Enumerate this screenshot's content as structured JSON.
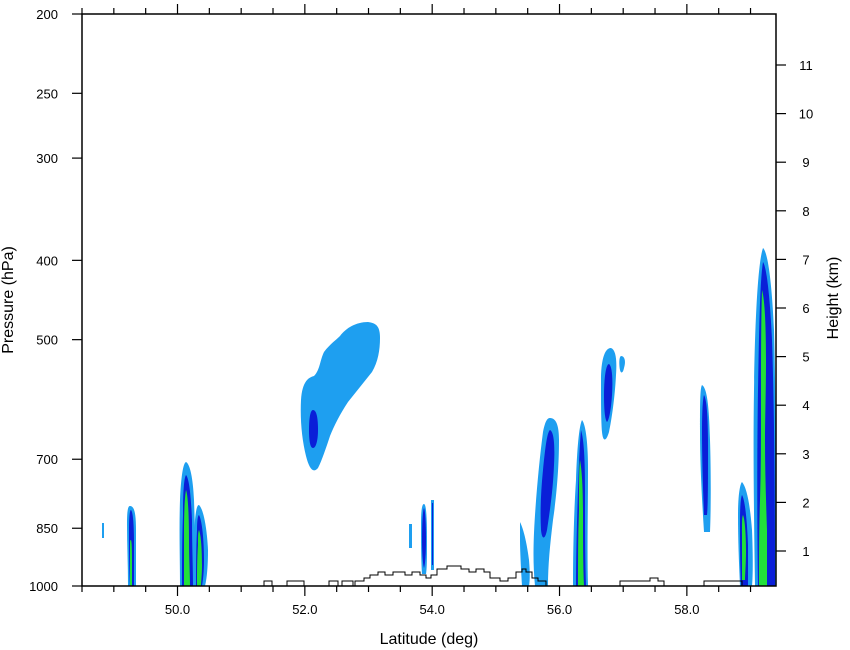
{
  "chart_data": {
    "type": "contour",
    "title": "",
    "xlabel": "Latitude (deg)",
    "ylabel_left": "Pressure (hPa)",
    "ylabel_right": "Height (km)",
    "xlim": [
      48.5,
      59.4
    ],
    "ylim_pressure": [
      1000,
      200
    ],
    "pressure_scale": "log",
    "x_ticks": [
      {
        "value": 50,
        "label": "50.0"
      },
      {
        "value": 52,
        "label": "52.0"
      },
      {
        "value": 54,
        "label": "54.0"
      },
      {
        "value": 56,
        "label": "56.0"
      },
      {
        "value": 58,
        "label": "58.0"
      }
    ],
    "y_ticks_pressure": [
      {
        "value": 200,
        "label": "200"
      },
      {
        "value": 250,
        "label": "250"
      },
      {
        "value": 300,
        "label": "300"
      },
      {
        "value": 400,
        "label": "400"
      },
      {
        "value": 500,
        "label": "500"
      },
      {
        "value": 700,
        "label": "700"
      },
      {
        "value": 850,
        "label": "850"
      },
      {
        "value": 1000,
        "label": "1000"
      }
    ],
    "y_ticks_height": [
      {
        "value": 1,
        "label": "1"
      },
      {
        "value": 2,
        "label": "2"
      },
      {
        "value": 3,
        "label": "3"
      },
      {
        "value": 4,
        "label": "4"
      },
      {
        "value": 5,
        "label": "5"
      },
      {
        "value": 6,
        "label": "6"
      },
      {
        "value": 7,
        "label": "7"
      },
      {
        "value": 8,
        "label": "8"
      },
      {
        "value": 9,
        "label": "9"
      },
      {
        "value": 10,
        "label": "10"
      },
      {
        "value": 11,
        "label": "11"
      }
    ],
    "colors": {
      "light_blue": "#1e9ff0",
      "dark_blue": "#0a1fd8",
      "green": "#22e03a",
      "terrain": "#000000"
    },
    "features": [
      {
        "name": "cell-49.2",
        "lat": 49.25,
        "p_top": 830,
        "p_bottom": 1000,
        "width": 0.1,
        "levels": [
          "light_blue",
          "dark_blue",
          "green"
        ]
      },
      {
        "name": "cell-50.1",
        "lat": 50.12,
        "p_top": 720,
        "p_bottom": 1000,
        "width": 0.2,
        "levels": [
          "light_blue",
          "dark_blue",
          "green"
        ]
      },
      {
        "name": "cell-50.3",
        "lat": 50.35,
        "p_top": 800,
        "p_bottom": 1000,
        "width": 0.2,
        "levels": [
          "light_blue",
          "dark_blue",
          "green"
        ]
      },
      {
        "name": "cloud-52.5",
        "lat_range": [
          51.95,
          53.1
        ],
        "p_range": [
          480,
          710
        ],
        "levels": [
          "light_blue",
          "dark_blue"
        ]
      },
      {
        "name": "cell-53.8",
        "lat": 53.82,
        "p_top": 810,
        "p_bottom": 960,
        "width": 0.06,
        "levels": [
          "light_blue",
          "dark_blue"
        ]
      },
      {
        "name": "cell-55.8",
        "lat": 55.8,
        "p_top": 640,
        "p_bottom": 1000,
        "width": 0.3,
        "levels": [
          "light_blue",
          "dark_blue"
        ]
      },
      {
        "name": "cell-56.4",
        "lat": 56.38,
        "p_top": 650,
        "p_bottom": 1000,
        "width": 0.18,
        "levels": [
          "light_blue",
          "dark_blue",
          "green"
        ]
      },
      {
        "name": "cell-56.8",
        "lat": 56.82,
        "p_top": 510,
        "p_bottom": 680,
        "width": 0.25,
        "levels": [
          "light_blue",
          "dark_blue"
        ]
      },
      {
        "name": "cell-58.3",
        "lat": 58.33,
        "p_top": 590,
        "p_bottom": 850,
        "width": 0.12,
        "levels": [
          "light_blue",
          "dark_blue"
        ]
      },
      {
        "name": "cell-58.9",
        "lat": 58.95,
        "p_top": 770,
        "p_bottom": 1000,
        "width": 0.2,
        "levels": [
          "light_blue",
          "dark_blue",
          "green"
        ]
      },
      {
        "name": "cell-59.2",
        "lat": 59.25,
        "p_top": 390,
        "p_bottom": 1000,
        "width": 0.3,
        "levels": [
          "light_blue",
          "dark_blue",
          "green"
        ]
      }
    ]
  }
}
